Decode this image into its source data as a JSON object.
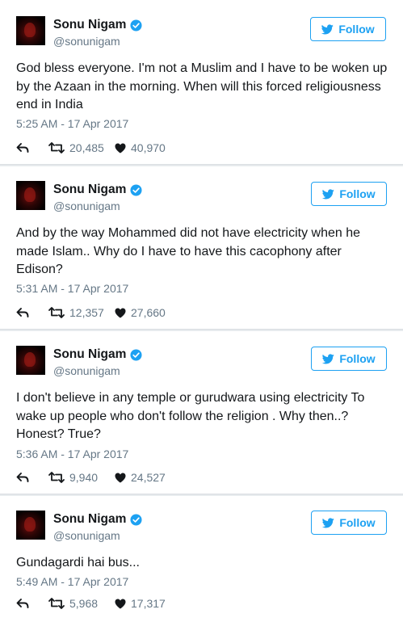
{
  "colors": {
    "brand_blue": "#1da1f2",
    "text": "#14171a",
    "secondary": "#657786"
  },
  "tweets": [
    {
      "author": {
        "name": "Sonu Nigam",
        "handle": "@sonunigam",
        "verified": true
      },
      "follow_label": "Follow",
      "text": "God bless everyone. I'm not a Muslim and I have to be woken up by the Azaan in the morning. When will this forced religiousness end in India",
      "time": "5:25 AM - 17 Apr 2017",
      "retweets": "20,485",
      "likes": "40,970"
    },
    {
      "author": {
        "name": "Sonu Nigam",
        "handle": "@sonunigam",
        "verified": true
      },
      "follow_label": "Follow",
      "text": "And by the way Mohammed did not have electricity when he made Islam.. Why do I have to have this cacophony after Edison?",
      "time": "5:31 AM - 17 Apr 2017",
      "retweets": "12,357",
      "likes": "27,660"
    },
    {
      "author": {
        "name": "Sonu Nigam",
        "handle": "@sonunigam",
        "verified": true
      },
      "follow_label": "Follow",
      "text": "I don't believe in any temple or gurudwara using electricity To wake up people who don't follow the religion . Why then..? Honest? True?",
      "time": "5:36 AM - 17 Apr 2017",
      "retweets": "9,940",
      "likes": "24,527"
    },
    {
      "author": {
        "name": "Sonu Nigam",
        "handle": "@sonunigam",
        "verified": true
      },
      "follow_label": "Follow",
      "text": "Gundagardi hai bus...",
      "time": "5:49 AM - 17 Apr 2017",
      "retweets": "5,968",
      "likes": "17,317"
    }
  ]
}
